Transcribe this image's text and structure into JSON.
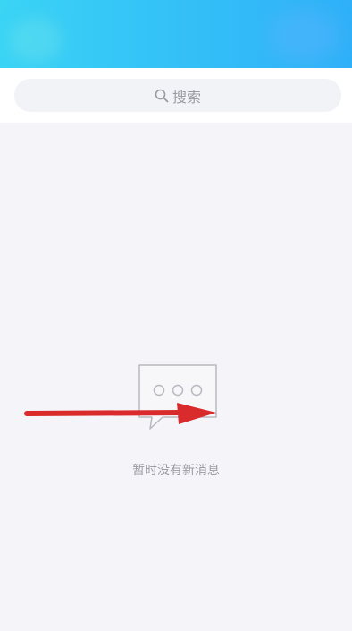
{
  "header": {
    "gradient_start": "#3ad4f5",
    "gradient_end": "#2fb0f8"
  },
  "search": {
    "placeholder": "搜索",
    "icon": "search-icon"
  },
  "empty_state": {
    "icon": "chat-bubble-icon",
    "message": "暂时没有新消息"
  },
  "annotation": {
    "type": "arrow",
    "color": "#d92b2b",
    "direction": "right"
  }
}
